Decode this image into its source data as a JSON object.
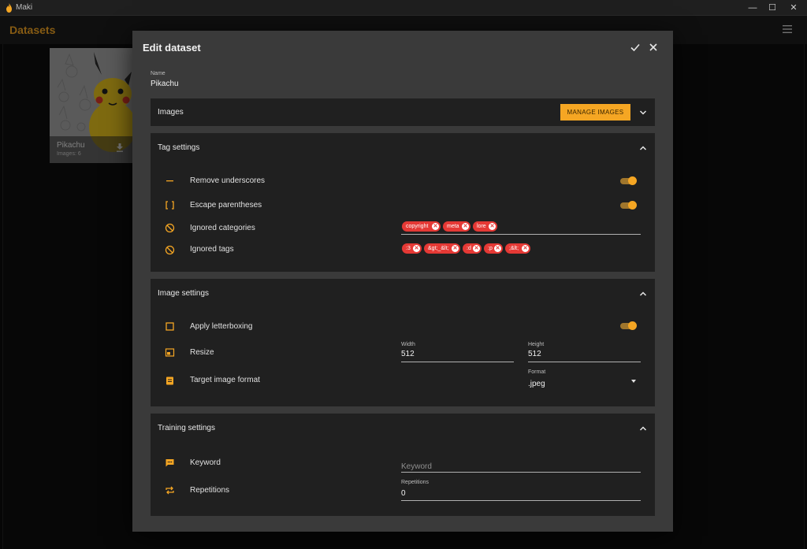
{
  "window": {
    "title": "Maki",
    "controls": [
      "—",
      "☐",
      "✕"
    ]
  },
  "appbar": {
    "title": "Datasets",
    "menu_icon": "hamburger-menu-icon"
  },
  "datasets": [
    {
      "name": "Pikachu",
      "count": "Images: 6"
    }
  ],
  "dialog": {
    "title": "Edit dataset",
    "name_label": "Name",
    "name_value": "Pikachu",
    "images_panel": {
      "title": "Images",
      "manage_button": "MANAGE IMAGES"
    },
    "tag_settings": {
      "title": "Tag settings",
      "remove_underscores": "Remove underscores",
      "escape_parentheses": "Escape parentheses",
      "ignored_categories": "Ignored categories",
      "ignored_categories_chips": [
        "copyright",
        "meta",
        "lore"
      ],
      "ignored_tags": "Ignored tags",
      "ignored_tags_chips": [
        ":3",
        "&gt;_&lt;",
        ":d",
        ":p",
        ";&lt;"
      ]
    },
    "image_settings": {
      "title": "Image settings",
      "apply_letterboxing": "Apply letterboxing",
      "resize": "Resize",
      "width_label": "Width",
      "width_value": "512",
      "height_label": "Height",
      "height_value": "512",
      "target_format": "Target image format",
      "format_label": "Format",
      "format_value": ".jpeg"
    },
    "training_settings": {
      "title": "Training settings",
      "keyword": "Keyword",
      "keyword_placeholder": "Keyword",
      "repetitions": "Repetitions",
      "repetitions_label": "Repetitions",
      "repetitions_value": "0"
    }
  },
  "colors": {
    "accent": "#f5a623",
    "chip": "#e53935",
    "panel": "#202020",
    "dialog": "#3a3a3a"
  }
}
